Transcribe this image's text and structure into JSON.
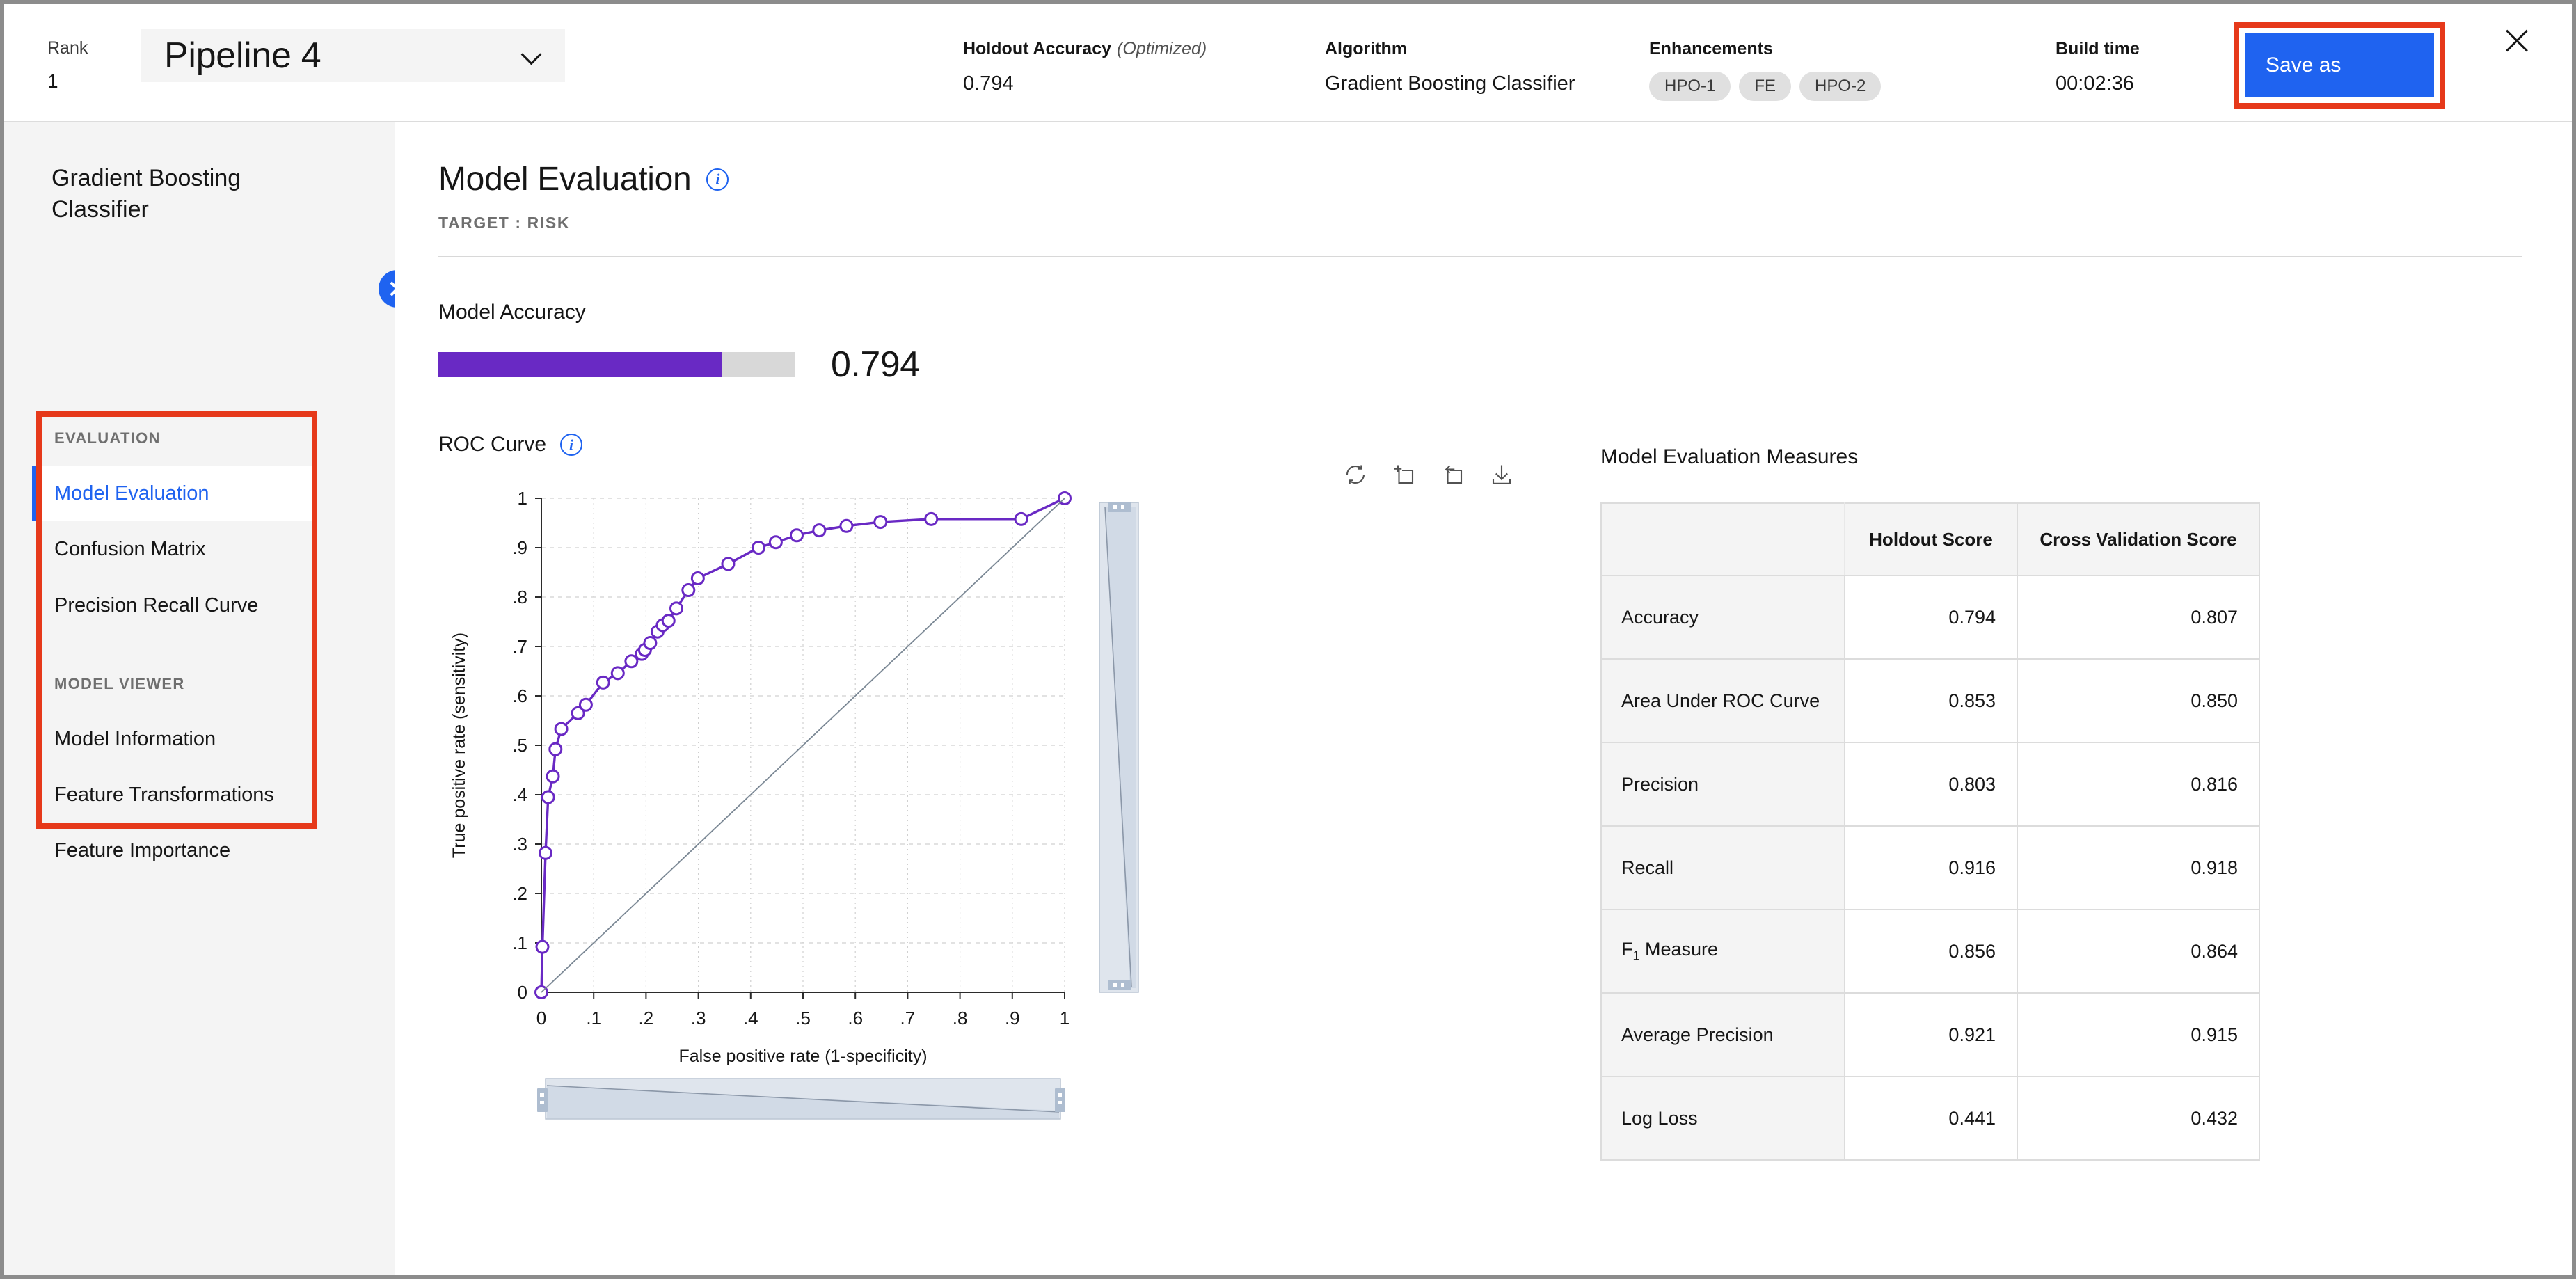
{
  "topbar": {
    "rank_label": "Rank",
    "rank_value": "1",
    "pipeline_name": "Pipeline 4",
    "chevron_icon": "chevron-down-icon",
    "holdout_accuracy_label": "Holdout Accuracy",
    "holdout_accuracy_optimized": "(Optimized)",
    "holdout_accuracy_value": "0.794",
    "algorithm_label": "Algorithm",
    "algorithm_value": "Gradient Boosting Classifier",
    "enhancements_label": "Enhancements",
    "enhancements": [
      "HPO-1",
      "FE",
      "HPO-2"
    ],
    "build_time_label": "Build time",
    "build_time_value": "00:02:36",
    "save_as_label": "Save as",
    "close_icon": "close-icon",
    "save_as_highlight_color": "#e6391a",
    "save_as_button_color": "#1f63f0"
  },
  "sidebar": {
    "title": "Gradient Boosting Classifier",
    "panel_close_icon": "close-icon",
    "highlight_color": "#e6391a",
    "groups": [
      {
        "label": "EVALUATION",
        "items": [
          {
            "label": "Model Evaluation",
            "active": true
          },
          {
            "label": "Confusion Matrix",
            "active": false
          },
          {
            "label": "Precision Recall Curve",
            "active": false
          }
        ]
      },
      {
        "label": "MODEL VIEWER",
        "items": [
          {
            "label": "Model Information",
            "active": false
          },
          {
            "label": "Feature Transformations",
            "active": false
          },
          {
            "label": "Feature Importance",
            "active": false
          }
        ]
      }
    ]
  },
  "main": {
    "page_title": "Model Evaluation",
    "page_title_info_icon": "info-icon",
    "page_subtitle": "TARGET : RISK",
    "accuracy_label": "Model Accuracy",
    "accuracy_value": "0.794",
    "accuracy_percent": 79.4,
    "accuracy_bar_color": "#6929c4",
    "roc_title": "ROC Curve",
    "roc_info_icon": "info-icon",
    "toolbar_icons": [
      "reset-zoom-icon",
      "zoom-in-icon",
      "zoom-out-icon",
      "download-icon"
    ],
    "measures_title": "Model Evaluation Measures",
    "measures_columns": [
      "",
      "Holdout Score",
      "Cross Validation Score"
    ],
    "measures_rows": [
      {
        "name": "Accuracy",
        "holdout": "0.794",
        "cv": "0.807"
      },
      {
        "name": "Area Under ROC Curve",
        "holdout": "0.853",
        "cv": "0.850"
      },
      {
        "name": "Precision",
        "holdout": "0.803",
        "cv": "0.816"
      },
      {
        "name": "Recall",
        "holdout": "0.916",
        "cv": "0.918"
      },
      {
        "name": "F1 Measure",
        "holdout": "0.856",
        "cv": "0.864",
        "sub": "1",
        "base": "F"
      },
      {
        "name": "Average Precision",
        "holdout": "0.921",
        "cv": "0.915"
      },
      {
        "name": "Log Loss",
        "holdout": "0.441",
        "cv": "0.432"
      }
    ]
  },
  "chart_data": {
    "type": "line",
    "title": "ROC Curve",
    "xlabel": "False positive rate (1-specificity)",
    "ylabel": "True positive rate (sensitivity)",
    "xlim": [
      0,
      1
    ],
    "ylim": [
      0,
      1
    ],
    "xticks": [
      "0",
      ".1",
      ".2",
      ".3",
      ".4",
      ".5",
      ".6",
      ".7",
      ".8",
      ".9",
      "1"
    ],
    "yticks": [
      "0",
      ".1",
      ".2",
      ".3",
      ".4",
      ".5",
      ".6",
      ".7",
      ".8",
      ".9",
      "1"
    ],
    "grid": true,
    "legend": "none",
    "series": [
      {
        "name": "ROC curve",
        "color": "#6929c4",
        "marker": "circle-open",
        "points": [
          [
            0.0,
            0.0
          ],
          [
            0.002,
            0.092
          ],
          [
            0.008,
            0.282
          ],
          [
            0.013,
            0.395
          ],
          [
            0.022,
            0.437
          ],
          [
            0.027,
            0.492
          ],
          [
            0.038,
            0.533
          ],
          [
            0.07,
            0.565
          ],
          [
            0.085,
            0.582
          ],
          [
            0.118,
            0.627
          ],
          [
            0.146,
            0.646
          ],
          [
            0.172,
            0.67
          ],
          [
            0.192,
            0.685
          ],
          [
            0.198,
            0.693
          ],
          [
            0.208,
            0.707
          ],
          [
            0.222,
            0.73
          ],
          [
            0.232,
            0.743
          ],
          [
            0.243,
            0.752
          ],
          [
            0.258,
            0.777
          ],
          [
            0.281,
            0.814
          ],
          [
            0.299,
            0.838
          ],
          [
            0.357,
            0.867
          ],
          [
            0.415,
            0.9
          ],
          [
            0.448,
            0.911
          ],
          [
            0.488,
            0.925
          ],
          [
            0.531,
            0.935
          ],
          [
            0.583,
            0.944
          ],
          [
            0.648,
            0.952
          ],
          [
            0.745,
            0.958
          ],
          [
            0.917,
            0.958
          ],
          [
            1.0,
            1.0
          ]
        ]
      },
      {
        "name": "Reference diagonal",
        "color": "#7a8794",
        "marker": "none",
        "points": [
          [
            0,
            0
          ],
          [
            1,
            1
          ]
        ]
      }
    ]
  }
}
